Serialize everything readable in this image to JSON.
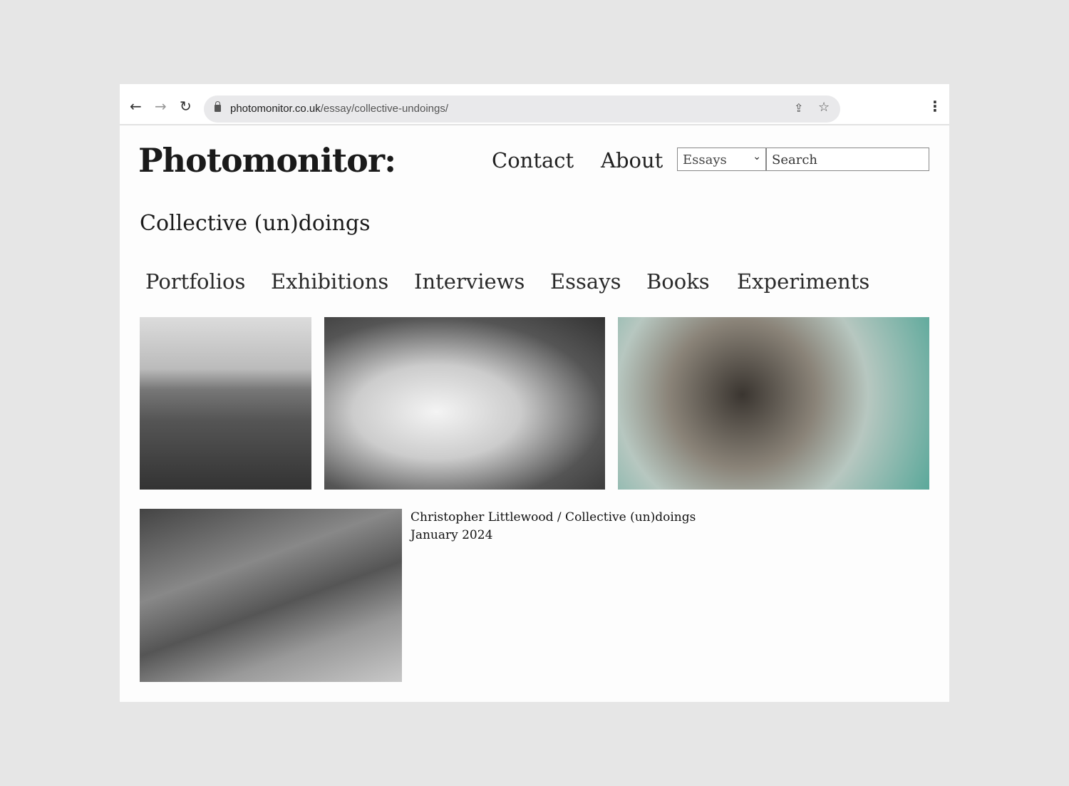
{
  "browser": {
    "url_domain": "photomonitor.co.uk",
    "url_path": "/essay/collective-undoings/",
    "back": "←",
    "forward": "→",
    "reload": "↻",
    "share": "⇪",
    "bookmark": "☆",
    "menu": "⋮"
  },
  "site": {
    "logo": "Photomonitor:",
    "nav": {
      "contact": "Contact",
      "about": "About"
    },
    "filter_selected": "Essays",
    "search_placeholder": "Search"
  },
  "page_title": "Collective (un)doings",
  "categories": [
    "Portfolios",
    "Exhibitions",
    "Interviews",
    "Essays",
    "Books",
    "Experiments"
  ],
  "caption": {
    "line1": "Christopher Littlewood / Collective (un)doings",
    "line2": "January 2024"
  }
}
